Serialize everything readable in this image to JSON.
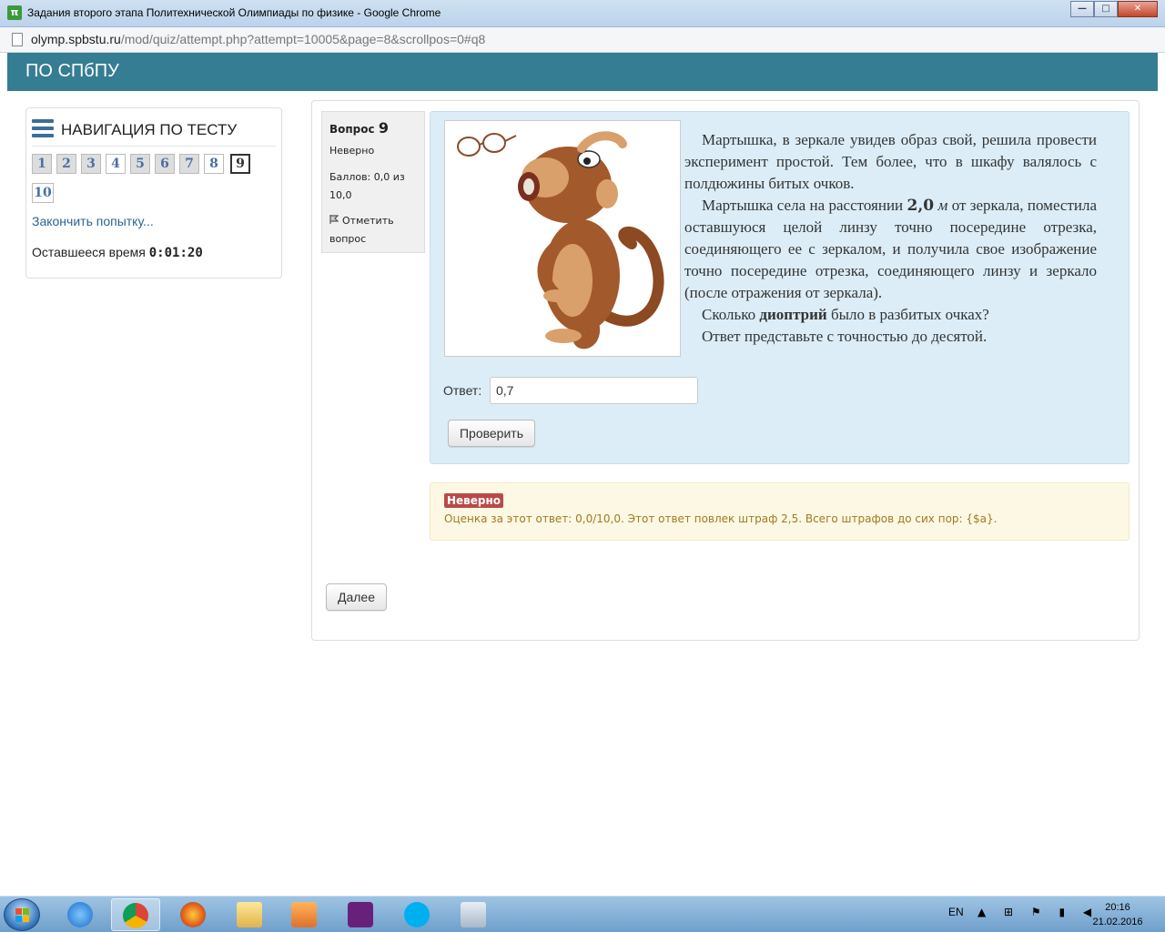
{
  "window": {
    "title": "Задания второго этапа Политехнической Олимпиады по физике - Google Chrome",
    "icon_text": "π",
    "btn_min": "—",
    "btn_max": "□",
    "btn_close": "✕"
  },
  "address": {
    "host": "olymp.spbstu.ru",
    "path": "/mod/quiz/attempt.php?attempt=10005&page=8&scrollpos=0#q8"
  },
  "site": {
    "name": "ПО СПбПУ"
  },
  "nav": {
    "title": "НАВИГАЦИЯ ПО ТЕСТУ",
    "questions": [
      "1",
      "2",
      "3",
      "4",
      "5",
      "6",
      "7",
      "8",
      "9",
      "10"
    ],
    "finish": "Закончить попытку...",
    "time_label": "Оставшееся время",
    "time_value": "0:01:20"
  },
  "question": {
    "label": "Вопрос",
    "number": "9",
    "state": "Неверно",
    "grade": "Баллов: 0,0 из 10,0",
    "flag": "Отметить вопрос",
    "p1": "Мартышка, в зеркале увидев образ свой, решила провести эксперимент простой. Тем более, что в шкафу валялось с полдюжины битых очков.",
    "p2_before": "Мартышка села на расстоянии",
    "p2_num": "2,0",
    "p2_unit": "м",
    "p2_after": "от зеркала, поместила оставшуюся целой линзу точно посередине отрезка, соединяющего ее с зеркалом, и получила свое изображение точно посередине отрезка, соединяющего линзу и зеркало (после отражения от зеркала).",
    "p3_before": "Сколько",
    "p3_bold": "диоптрий",
    "p3_after": "было в разбитых очках?",
    "p4": "Ответ представьте с точностью до десятой.",
    "answer_label": "Ответ:",
    "answer_value": "0,7",
    "check_button": "Проверить"
  },
  "outcome": {
    "badge": "Неверно",
    "feedback": "Оценка за этот ответ: 0,0/10,0. Этот ответ повлек штраф 2,5. Всего штрафов до сих пор: {$a}."
  },
  "next_button": "Далее",
  "taskbar": {
    "lang": "EN",
    "tray": "▲ ⊞ ⚑ ▮ ◀",
    "time": "20:16",
    "date": "21.02.2016"
  }
}
